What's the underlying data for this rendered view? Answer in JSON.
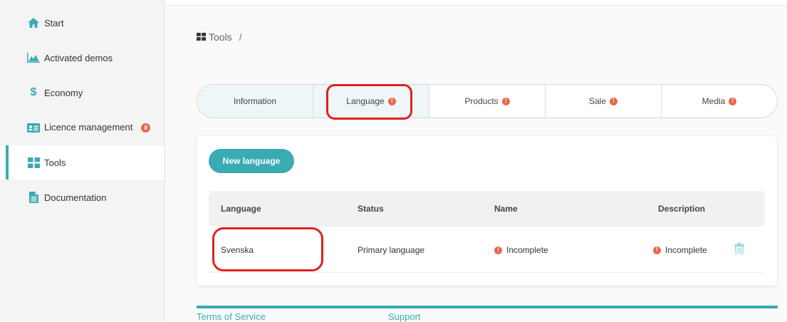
{
  "sidebar": {
    "items": [
      {
        "label": "Start",
        "icon": "home-icon"
      },
      {
        "label": "Activated demos",
        "icon": "area-chart-icon"
      },
      {
        "label": "Economy",
        "icon": "dollar-icon"
      },
      {
        "label": "Licence management",
        "icon": "id-card-icon",
        "badge": "8"
      },
      {
        "label": "Tools",
        "icon": "grid-icon",
        "active": true
      },
      {
        "label": "Documentation",
        "icon": "file-icon"
      }
    ]
  },
  "breadcrumb": {
    "label": "Tools",
    "separator": "/"
  },
  "tabs": [
    {
      "label": "Information"
    },
    {
      "label": "Language",
      "warning": "!"
    },
    {
      "label": "Products",
      "warning": "!"
    },
    {
      "label": "Sale",
      "warning": "!"
    },
    {
      "label": "Media",
      "warning": "!"
    }
  ],
  "card": {
    "new_button": "New language",
    "columns": [
      "Language",
      "Status",
      "Name",
      "Description"
    ],
    "rows": [
      {
        "language": "Svenska",
        "status": "Primary language",
        "name": "Incomplete",
        "description": "Incomplete",
        "warning": "!"
      }
    ]
  },
  "footer": {
    "links": [
      "Terms of Service",
      "Support"
    ]
  },
  "colors": {
    "accent": "#3aabb3",
    "warning": "#e9684d",
    "annotation": "#e02020"
  }
}
